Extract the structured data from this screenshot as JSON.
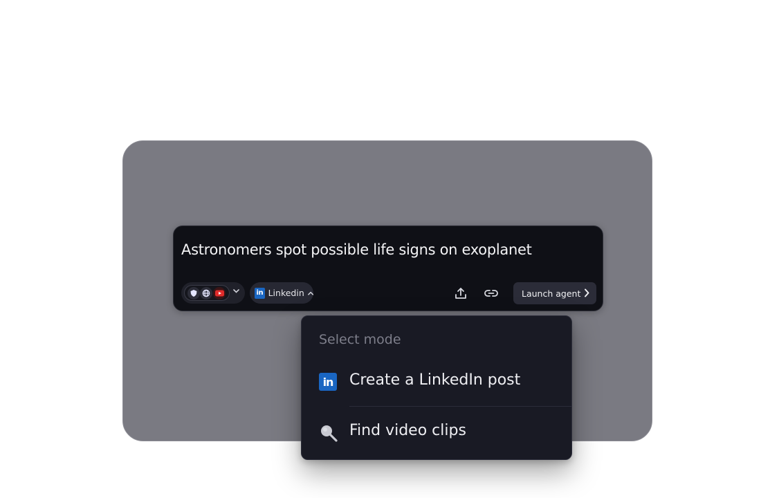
{
  "prompt": {
    "text": "Astronomers spot possible life signs on exoplanet"
  },
  "toolbar": {
    "sources_icons": [
      "shield-icon",
      "globe-icon",
      "youtube-icon"
    ],
    "mode_label": "Linkedin",
    "upload_icon": "upload-icon",
    "link_icon": "link-icon",
    "launch_label": "Launch agent"
  },
  "dropdown": {
    "title": "Select mode",
    "items": [
      {
        "label": "Create a LinkedIn post",
        "icon": "linkedin-icon"
      },
      {
        "label": "Find video clips",
        "icon": "search-icon"
      }
    ]
  },
  "colors": {
    "stage": "#7a7a82",
    "card": "#0f1016",
    "dropdown": "#191a24",
    "linkedin": "#1a66c2",
    "youtube": "#e02b2b"
  }
}
